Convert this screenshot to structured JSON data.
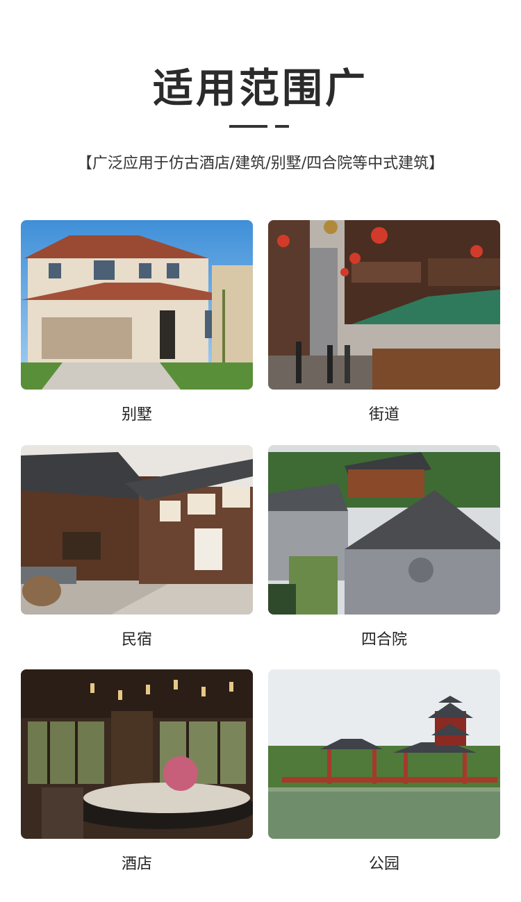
{
  "header": {
    "title": "适用范围广",
    "subtitle": "【广泛应用于仿古酒店/建筑/别墅/四合院等中式建筑】"
  },
  "gallery": [
    {
      "label": "别墅"
    },
    {
      "label": "街道"
    },
    {
      "label": "民宿"
    },
    {
      "label": "四合院"
    },
    {
      "label": "酒店"
    },
    {
      "label": "公园"
    }
  ]
}
